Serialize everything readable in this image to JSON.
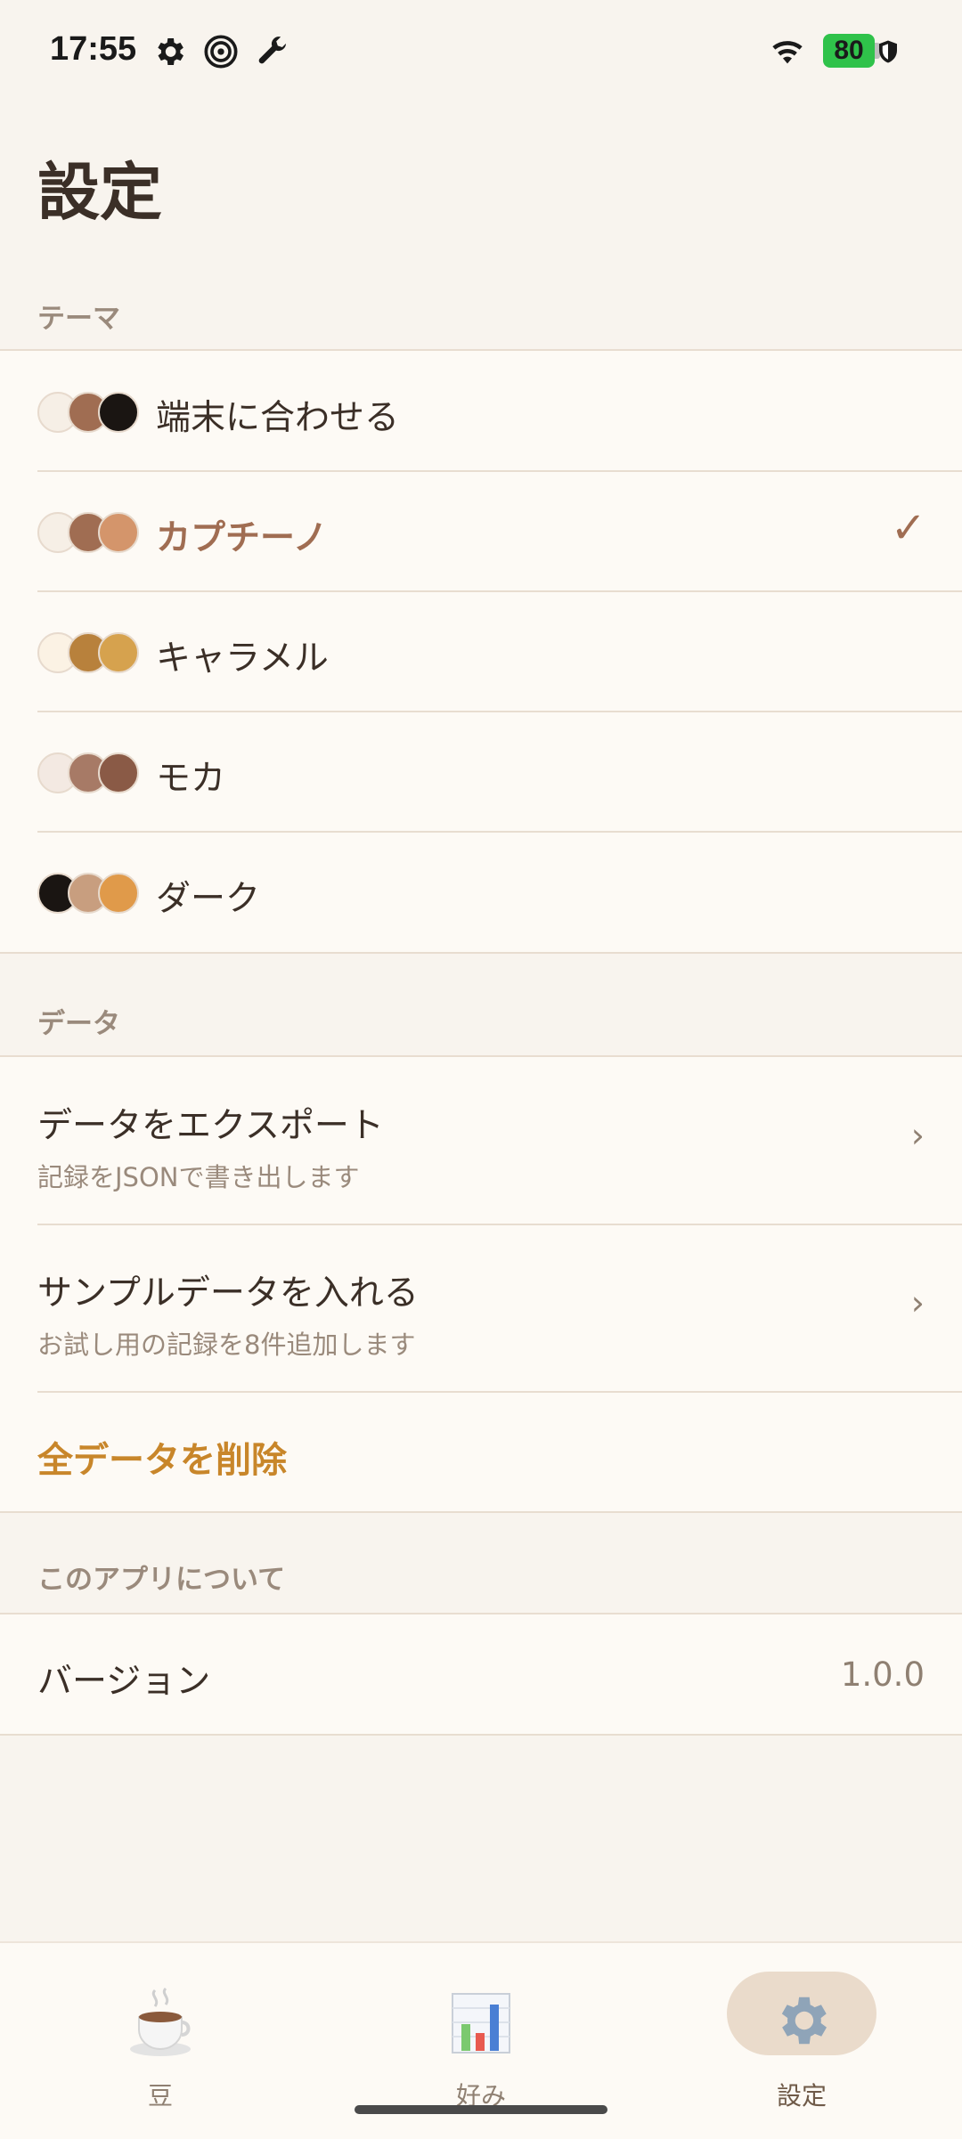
{
  "status_bar": {
    "time": "17:55",
    "battery": "80"
  },
  "page": {
    "title": "設定"
  },
  "theme_section": {
    "header": "テーマ",
    "items": [
      {
        "label": "端末に合わせる",
        "selected": false,
        "swatches": [
          "#f6efe6",
          "#a06d52",
          "#1a1512"
        ]
      },
      {
        "label": "カプチーノ",
        "selected": true,
        "swatches": [
          "#f6efe6",
          "#a06d52",
          "#d4956b"
        ]
      },
      {
        "label": "キャラメル",
        "selected": false,
        "swatches": [
          "#fbf2e4",
          "#b8813c",
          "#d6a24e"
        ]
      },
      {
        "label": "モカ",
        "selected": false,
        "swatches": [
          "#f3e9e2",
          "#a77a66",
          "#8a5a46"
        ]
      },
      {
        "label": "ダーク",
        "selected": false,
        "swatches": [
          "#1a1512",
          "#c89e7f",
          "#e09a4a"
        ]
      }
    ],
    "check": "✓"
  },
  "data_section": {
    "header": "データ",
    "export": {
      "title": "データをエクスポート",
      "subtitle": "記録をJSONで書き出します"
    },
    "sample": {
      "title": "サンプルデータを入れる",
      "subtitle": "お試し用の記録を8件追加します"
    },
    "delete_label": "全データを削除",
    "chevron": "›"
  },
  "about_section": {
    "header": "このアプリについて",
    "version_label": "バージョン",
    "version_value": "1.0.0"
  },
  "bottom_nav": {
    "items": [
      {
        "label": "豆",
        "icon": "coffee-cup-icon",
        "active": false
      },
      {
        "label": "好み",
        "icon": "bar-chart-icon",
        "active": false
      },
      {
        "label": "設定",
        "icon": "gear-icon",
        "active": true
      }
    ]
  },
  "colors": {
    "accent": "#a06d52",
    "danger": "#c8862a",
    "background": "#f8f4ee",
    "card": "#fdfaf5"
  }
}
